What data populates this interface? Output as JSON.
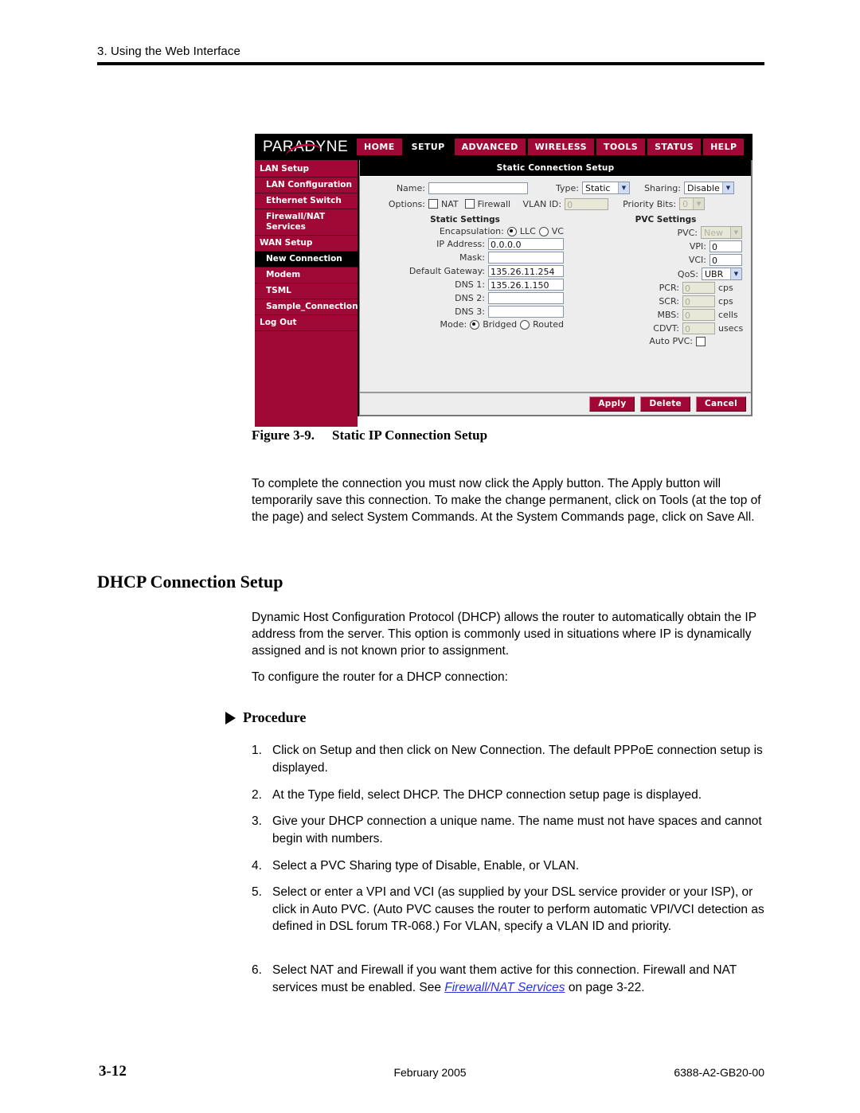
{
  "page": {
    "running_head": "3. Using the Web Interface",
    "footer_page": "3-12",
    "footer_date": "February 2005",
    "footer_doc": "6388-A2-GB20-00"
  },
  "screenshot": {
    "brand": "PARADYNE",
    "nav_tabs": [
      {
        "label": "HOME",
        "active": false
      },
      {
        "label": "SETUP",
        "active": true
      },
      {
        "label": "ADVANCED",
        "active": false
      },
      {
        "label": "WIRELESS",
        "active": false
      },
      {
        "label": "TOOLS",
        "active": false
      },
      {
        "label": "STATUS",
        "active": false
      },
      {
        "label": "HELP",
        "active": false
      }
    ],
    "sidebar": [
      {
        "label": "LAN Setup",
        "sub": false,
        "active": false
      },
      {
        "label": "LAN Configuration",
        "sub": true,
        "active": false
      },
      {
        "label": "Ethernet Switch",
        "sub": true,
        "active": false
      },
      {
        "label": "Firewall/NAT Services",
        "sub": true,
        "active": false
      },
      {
        "label": "WAN Setup",
        "sub": false,
        "active": false
      },
      {
        "label": "New Connection",
        "sub": true,
        "active": true
      },
      {
        "label": "Modem",
        "sub": true,
        "active": false
      },
      {
        "label": "TSML",
        "sub": true,
        "active": false
      },
      {
        "label": "Sample_Connection",
        "sub": true,
        "active": false
      },
      {
        "label": "Log Out",
        "sub": false,
        "active": false
      }
    ],
    "panel_title": "Static Connection Setup",
    "top_form": {
      "name_label": "Name:",
      "name_value": "",
      "type_label": "Type:",
      "type_value": "Static",
      "sharing_label": "Sharing:",
      "sharing_value": "Disable",
      "options_label": "Options:",
      "nat_label": "NAT",
      "firewall_label": "Firewall",
      "vlan_id_label": "VLAN ID:",
      "vlan_id_value": "0",
      "priority_bits_label": "Priority Bits:",
      "priority_bits_value": "0"
    },
    "static_settings": {
      "heading": "Static Settings",
      "encapsulation_label": "Encapsulation:",
      "encap_llc": "LLC",
      "encap_vc": "VC",
      "ip_address_label": "IP Address:",
      "ip_address_value": "0.0.0.0",
      "mask_label": "Mask:",
      "mask_value": "",
      "gateway_label": "Default Gateway:",
      "gateway_value": "135.26.11.254",
      "dns1_label": "DNS 1:",
      "dns1_value": "135.26.1.150",
      "dns2_label": "DNS 2:",
      "dns2_value": "",
      "dns3_label": "DNS 3:",
      "dns3_value": "",
      "mode_label": "Mode:",
      "mode_bridged": "Bridged",
      "mode_routed": "Routed"
    },
    "pvc_settings": {
      "heading": "PVC Settings",
      "pvc_label": "PVC:",
      "pvc_value": "New",
      "vpi_label": "VPI:",
      "vpi_value": "0",
      "vci_label": "VCI:",
      "vci_value": "0",
      "qos_label": "QoS:",
      "qos_value": "UBR",
      "pcr_label": "PCR:",
      "pcr_value": "0",
      "pcr_unit": "cps",
      "scr_label": "SCR:",
      "scr_value": "0",
      "scr_unit": "cps",
      "mbs_label": "MBS:",
      "mbs_value": "0",
      "mbs_unit": "cells",
      "cdvt_label": "CDVT:",
      "cdvt_value": "0",
      "cdvt_unit": "usecs",
      "auto_pvc_label": "Auto PVC:"
    },
    "buttons": {
      "apply": "Apply",
      "delete": "Delete",
      "cancel": "Cancel"
    }
  },
  "figure": {
    "number": "Figure 3-9.",
    "title": "Static IP Connection Setup"
  },
  "content": {
    "paragraph_apply": "To complete the connection you must now click the Apply button. The Apply button will temporarily save this connection. To make the change permanent, click on Tools (at the top of the page) and select System Commands. At the System Commands page, click on Save All.",
    "dhcp_heading": "DHCP Connection Setup",
    "dhcp_intro": "Dynamic Host Configuration Protocol (DHCP) allows the router to automatically obtain the IP address from the server. This option is commonly used in situations where IP is dynamically assigned and is not known prior to assignment.",
    "dhcp_lead_in": "To configure the router for a DHCP connection:",
    "procedure_heading": "Procedure",
    "steps": [
      {
        "num": "1.",
        "text": "Click on Setup and then click on New Connection. The default PPPoE connection setup is displayed."
      },
      {
        "num": "2.",
        "text": "At the Type field, select DHCP. The DHCP connection setup page is displayed."
      },
      {
        "num": "3.",
        "text": "Give your DHCP connection a unique name. The name must not have spaces and cannot begin with numbers."
      },
      {
        "num": "4.",
        "text": "Select a PVC Sharing type of Disable, Enable, or VLAN."
      },
      {
        "num": "5.",
        "text": "Select or enter a VPI and VCI (as supplied by your DSL service provider or your ISP), or click in Auto PVC. (Auto PVC causes the router to perform automatic VPI/VCI detection as defined in DSL forum TR-068.) For VLAN, specify a VLAN ID and priority."
      }
    ],
    "step6": {
      "num": "6.",
      "text_before": "Select NAT and Firewall if you want them active for this connection. Firewall and NAT services must be enabled. See ",
      "link": "Firewall/NAT Services",
      "text_after": " on page 3-22."
    }
  }
}
